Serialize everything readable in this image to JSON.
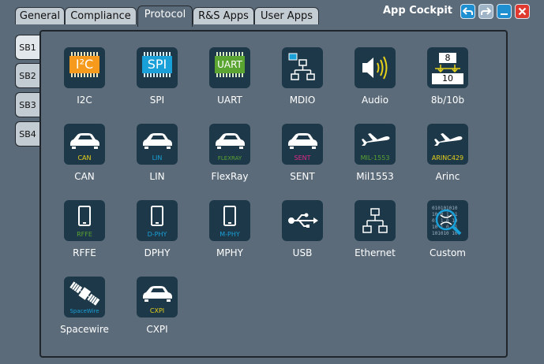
{
  "tabs": [
    "General",
    "Compliance",
    "Protocol",
    "R&S Apps",
    "User Apps"
  ],
  "app_title": "App Cockpit",
  "window_buttons": [
    "back-icon",
    "forward-icon",
    "minimize-icon",
    "close-icon"
  ],
  "side_tabs": [
    "SB1",
    "SB2",
    "SB3",
    "SB4"
  ],
  "items": [
    {
      "label": "I2C",
      "icon": "i2c-chip-icon",
      "sub": "I²C"
    },
    {
      "label": "SPI",
      "icon": "spi-chip-icon",
      "sub": "SPI"
    },
    {
      "label": "UART",
      "icon": "uart-chip-icon",
      "sub": "UART"
    },
    {
      "label": "MDIO",
      "icon": "network-tree-icon",
      "sub": ""
    },
    {
      "label": "Audio",
      "icon": "speaker-icon",
      "sub": ""
    },
    {
      "label": "8b/10b",
      "icon": "encoding-icon",
      "sub": "8",
      "sub2": "10"
    },
    {
      "label": "CAN",
      "icon": "car-icon",
      "sub": "CAN"
    },
    {
      "label": "LIN",
      "icon": "car-icon",
      "sub": "LIN"
    },
    {
      "label": "FlexRay",
      "icon": "car-icon",
      "sub": "FLEXRAY"
    },
    {
      "label": "SENT",
      "icon": "car-icon",
      "sub": "SENT"
    },
    {
      "label": "Mil1553",
      "icon": "airplane-icon",
      "sub": "MIL-1553"
    },
    {
      "label": "Arinc",
      "icon": "airplane-icon",
      "sub": "ARINC429"
    },
    {
      "label": "RFFE",
      "icon": "phone-icon",
      "sub": "RFFE"
    },
    {
      "label": "DPHY",
      "icon": "phone-icon",
      "sub": "D-PHY"
    },
    {
      "label": "MPHY",
      "icon": "phone-icon",
      "sub": "M-PHY"
    },
    {
      "label": "USB",
      "icon": "usb-icon",
      "sub": ""
    },
    {
      "label": "Ethernet",
      "icon": "ethernet-icon",
      "sub": ""
    },
    {
      "label": "Custom",
      "icon": "custom-decode-icon",
      "sub": ""
    },
    {
      "label": "Spacewire",
      "icon": "satellite-icon",
      "sub": "SpaceWire"
    },
    {
      "label": "CXPI",
      "icon": "car-icon",
      "sub": "CXPI"
    }
  ],
  "colors": {
    "background": "#5b6b7a",
    "icon_bg": "#1d3848",
    "accent_orange": "#f59a1c",
    "accent_blue": "#1aa0d8",
    "accent_green": "#5aa532",
    "accent_yellow": "#e8d21a",
    "accent_magenta": "#e0288a",
    "window_blue": "#1e8fd0",
    "window_red": "#e0392f"
  }
}
